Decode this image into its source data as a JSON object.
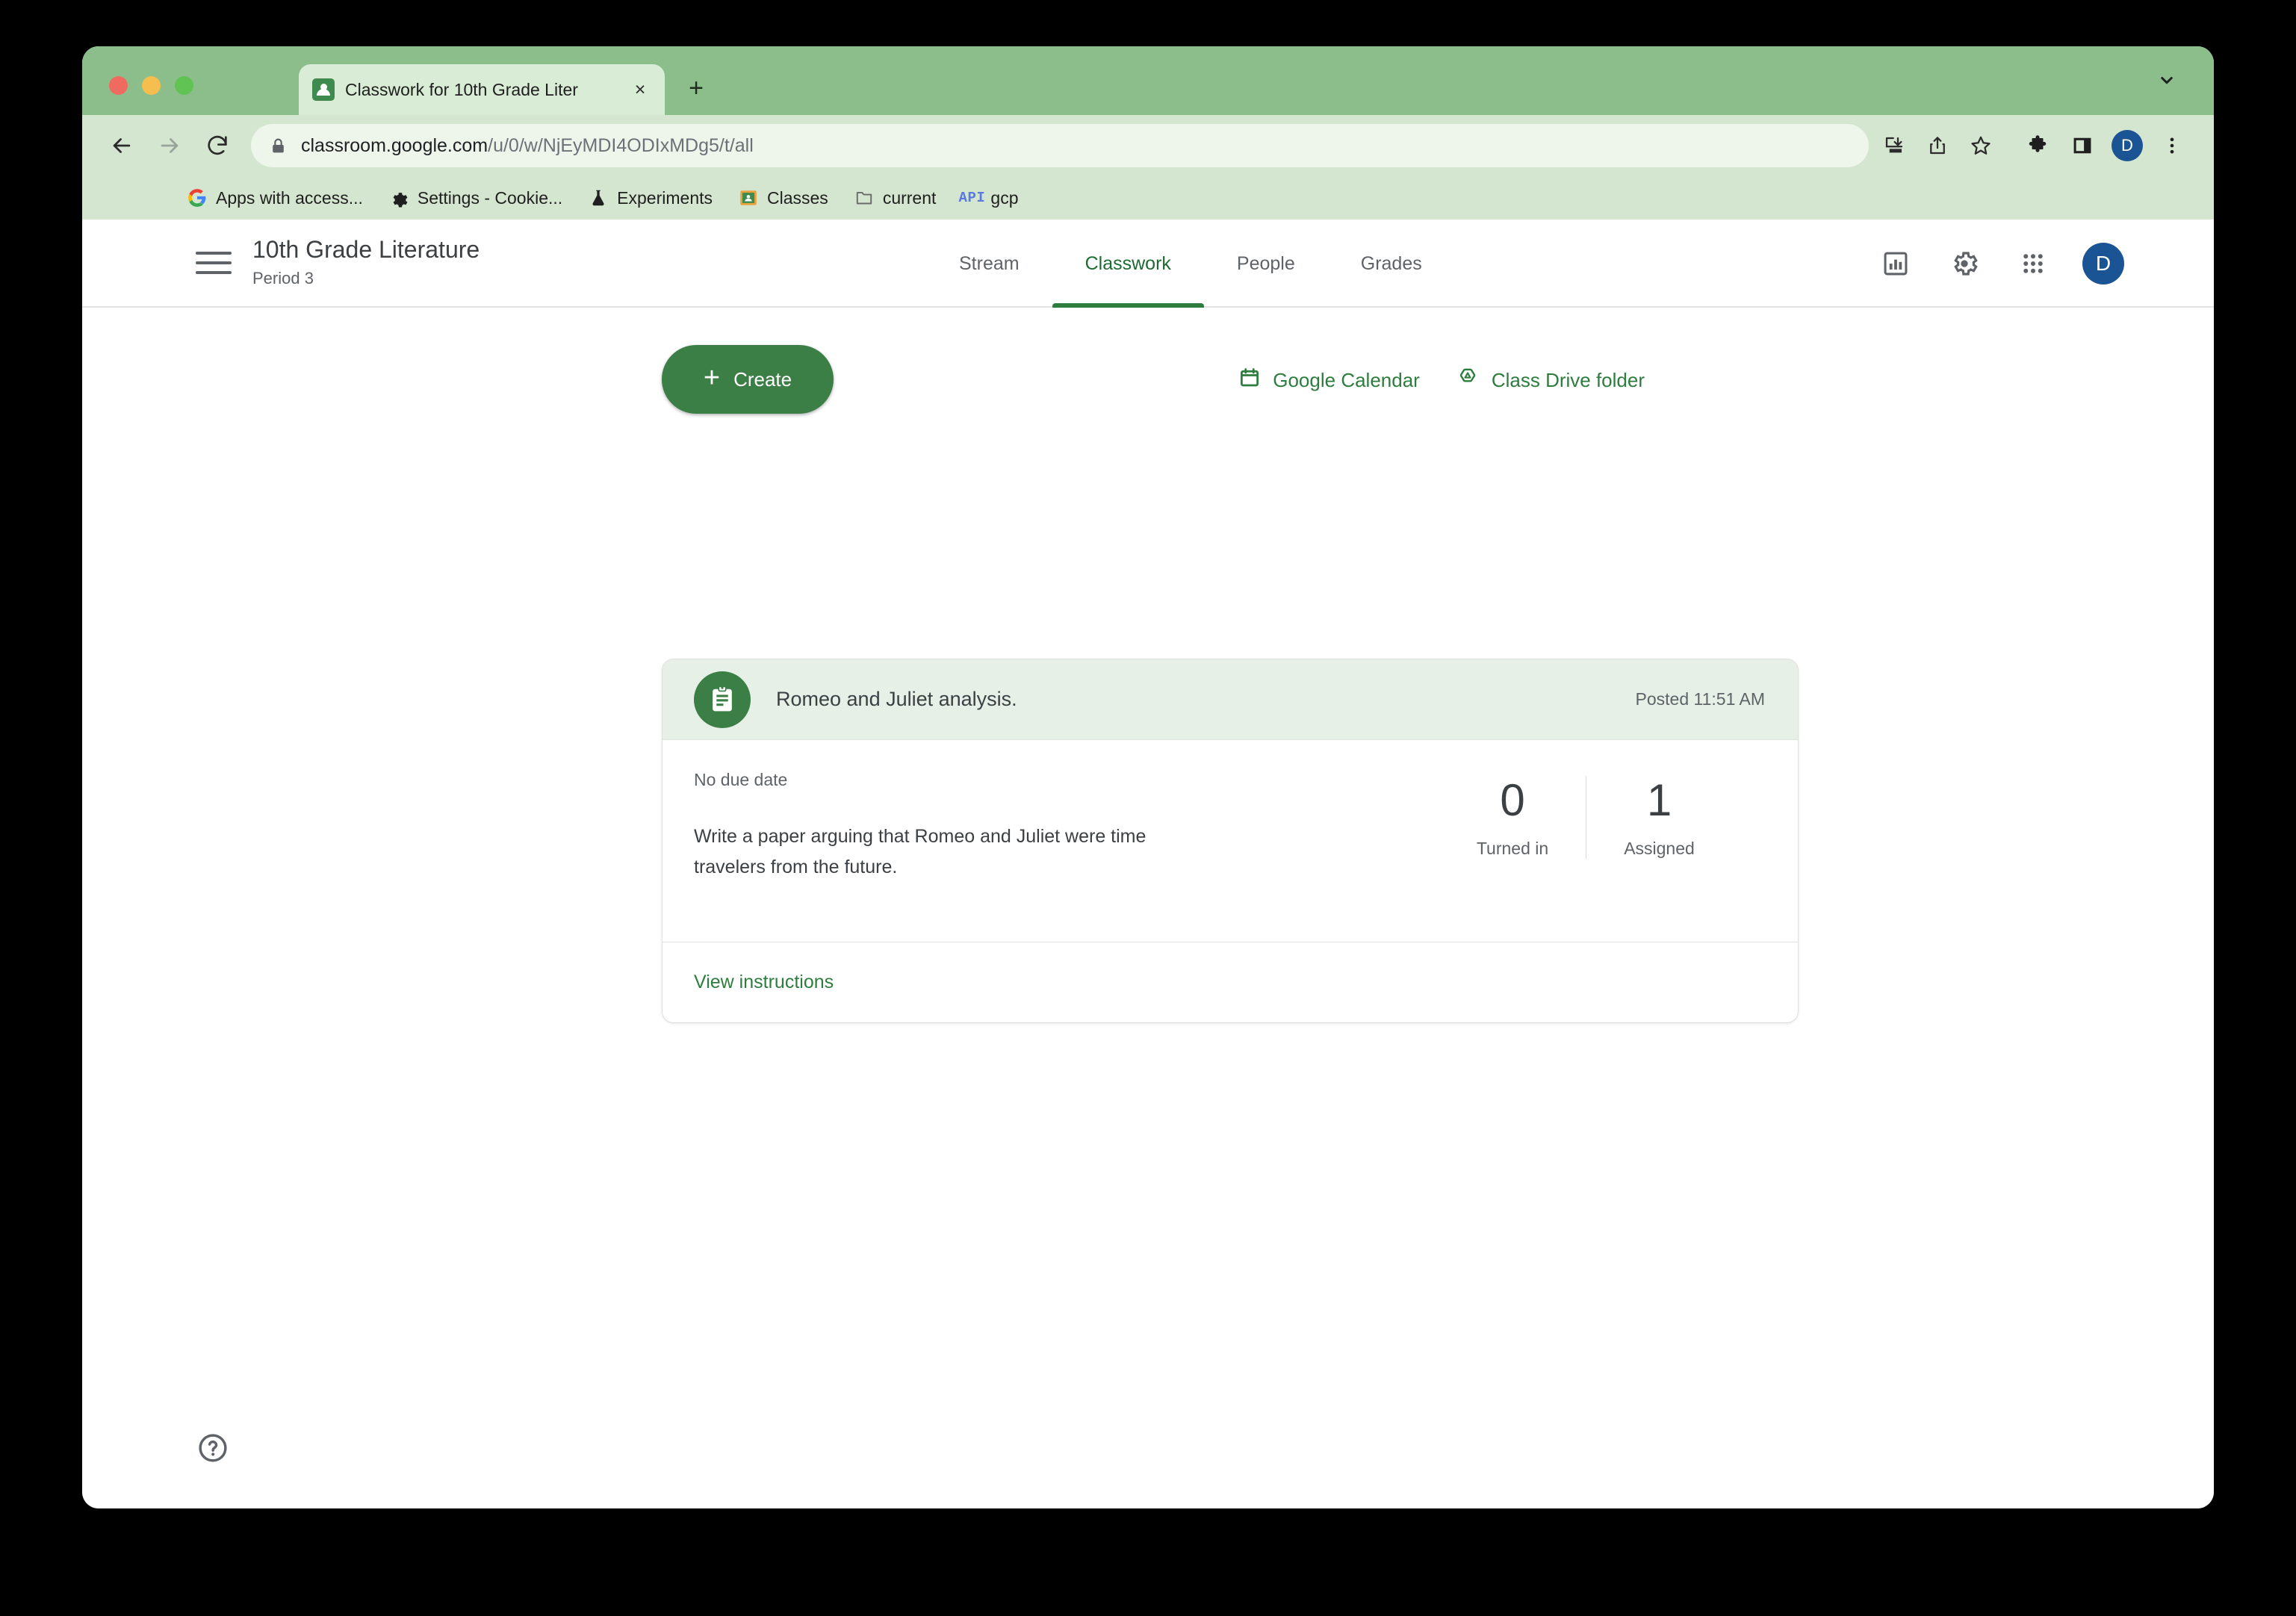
{
  "browser": {
    "tab": {
      "title": "Classwork for 10th Grade Liter",
      "favicon": "classroom-favicon",
      "close": "×"
    },
    "new_tab_label": "+",
    "tab_search_icon": "chevron-down-icon",
    "url": {
      "host": "classroom.google.com",
      "path": "/u/0/w/NjEyMDI4ODIxMDg5/t/all",
      "lock_icon": "lock-icon"
    },
    "nav": {
      "back": "←",
      "forward": "→",
      "reload": "⟳"
    },
    "omnibox_actions": [
      "install-icon",
      "share-icon",
      "bookmark-star-icon"
    ],
    "toolbar_right": [
      "extensions-puzzle-icon",
      "side-panel-icon"
    ],
    "profile_initial": "D",
    "menu_icon": "three-dot-menu-icon",
    "bookmarks": [
      {
        "label": "Apps with access...",
        "icon": "google-g-icon"
      },
      {
        "label": "Settings - Cookie...",
        "icon": "gear-icon"
      },
      {
        "label": "Experiments",
        "icon": "flask-icon"
      },
      {
        "label": "Classes",
        "icon": "classroom-icon"
      },
      {
        "label": "current",
        "icon": "folder-icon"
      },
      {
        "label": "gcp",
        "icon": "api-icon",
        "icon_text": "API"
      }
    ]
  },
  "app_header": {
    "menu_icon": "hamburger-menu-icon",
    "class_title": "10th Grade Literature",
    "class_section": "Period 3",
    "tabs": [
      {
        "label": "Stream",
        "active": false
      },
      {
        "label": "Classwork",
        "active": true
      },
      {
        "label": "People",
        "active": false
      },
      {
        "label": "Grades",
        "active": false
      }
    ],
    "right_icons": [
      "assessment-icon",
      "gear-icon",
      "apps-grid-icon"
    ],
    "avatar_initial": "D"
  },
  "actions": {
    "create_label": "Create",
    "create_plus": "+",
    "links": [
      {
        "label": "Google Calendar",
        "icon": "calendar-icon"
      },
      {
        "label": "Class Drive folder",
        "icon": "drive-folder-icon"
      }
    ]
  },
  "assignment": {
    "icon": "assignment-clipboard-icon",
    "title": "Romeo and Juliet analysis.",
    "posted": "Posted 11:51 AM",
    "due_date": "No due date",
    "description": "Write a paper arguing that Romeo and Juliet were time travelers from the future.",
    "stats": [
      {
        "value": "0",
        "label": "Turned in"
      },
      {
        "value": "1",
        "label": "Assigned"
      }
    ],
    "footer_link": "View instructions"
  },
  "help": {
    "icon": "help-circle-icon"
  },
  "colors": {
    "brand_green": "#2d7d3e",
    "create_green": "#3c7f46",
    "tabstrip_green": "#8cbe8c",
    "toolbar_green": "#d4e6d0",
    "omnibox_green": "#eef6ec",
    "card_header_green": "#e6f0e6",
    "avatar_blue": "#1a5494"
  }
}
